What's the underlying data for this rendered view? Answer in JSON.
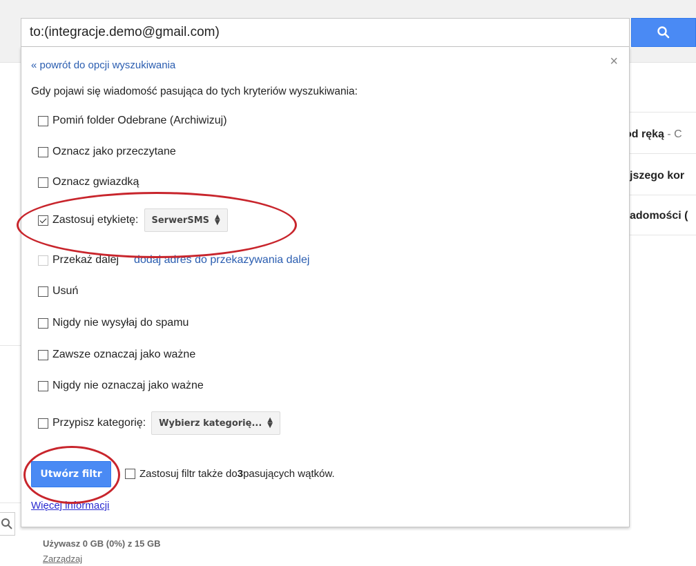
{
  "search": {
    "query": "to:(integracje.demo@gmail.com)"
  },
  "filter_panel": {
    "back_link": "« powrót do opcji wyszukiwania",
    "close": "×",
    "intro": "Gdy pojawi się wiadomość pasująca do tych kryteriów wyszukiwania:",
    "options": [
      {
        "label": "Pomiń folder Odebrane (Archiwizuj)",
        "checked": false
      },
      {
        "label": "Oznacz jako przeczytane",
        "checked": false
      },
      {
        "label": "Oznacz gwiazdką",
        "checked": false
      },
      {
        "label": "Zastosuj etykietę:",
        "checked": true,
        "select_value": "SerwerSMS"
      },
      {
        "label": "Przekaż dalej",
        "checked": false,
        "disabled": true,
        "link": "dodaj adres do przekazywania dalej"
      },
      {
        "label": "Usuń",
        "checked": false
      },
      {
        "label": "Nigdy nie wysyłaj do spamu",
        "checked": false
      },
      {
        "label": "Zawsze oznaczaj jako ważne",
        "checked": false
      },
      {
        "label": "Nigdy nie oznaczaj jako ważne",
        "checked": false
      },
      {
        "label": "Przypisz kategorię:",
        "checked": false,
        "select_value": "Wybierz kategorię..."
      }
    ],
    "create_button": "Utwórz filtr",
    "also_apply_prefix": "Zastosuj filtr także do ",
    "also_apply_count": "3",
    "also_apply_suffix": " pasujących wątków.",
    "more_info": "Więcej informacji"
  },
  "background": {
    "row1_bold": "od ręką",
    "row1_rest": " - C",
    "row2": "jszego kor",
    "row3": "adomości ("
  },
  "storage": {
    "usage": "Używasz 0 GB (0%) z 15 GB",
    "manage": "Zarządzaj"
  },
  "colors": {
    "accent": "#4a8af4",
    "annotation": "#c8252c",
    "link": "#2a5db0"
  }
}
